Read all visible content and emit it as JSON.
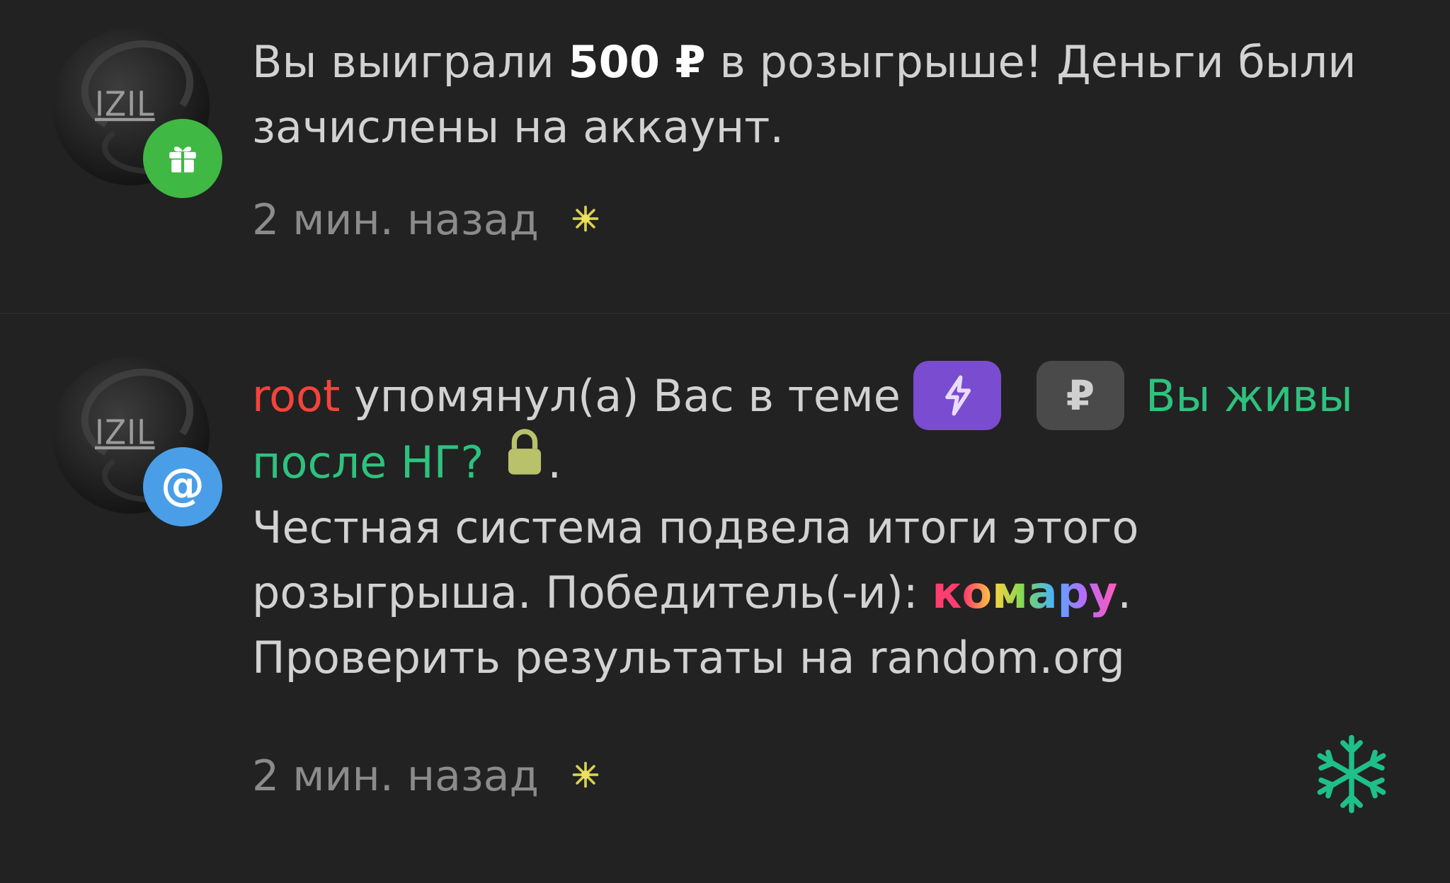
{
  "colors": {
    "background": "#222222",
    "text": "#d2d2d2",
    "muted": "#8b8b8b",
    "username": "#f5433b",
    "topic_link": "#2ec27e",
    "gift_badge": "#3fb844",
    "mention_badge": "#4a9ee8",
    "prefix_purple": "#7a4ccf",
    "prefix_gray": "#4a4a4a",
    "lock": "#b9c26a",
    "snowflake": "#1fbf8a",
    "sparkle": "#d8d050"
  },
  "notifications": [
    {
      "type": "gift",
      "badge_icon": "gift-icon",
      "avatar_text": "IZIL",
      "text_before": "Вы выиграли ",
      "amount": "500 ₽",
      "text_after": " в розыгрыше! Деньги были зачислены на аккаунт.",
      "time": "2 мин. назад",
      "time_icon": "sparkle-icon"
    },
    {
      "type": "mention",
      "badge_icon": "at-icon",
      "badge_text": "@",
      "avatar_text": "IZIL",
      "username": "root",
      "action_text": " упомянул(а) Вас в теме",
      "prefix_icons": [
        "lightning-icon",
        "ruble-icon"
      ],
      "prefix_ruble": "₽",
      "topic_title": "Вы живы после НГ?",
      "topic_icon": "lock-icon",
      "after_topic": ".",
      "body_text": "Честная система подвела итоги этого розыгрыша. Победитель(-и): ",
      "winner": "комару",
      "after_winner": ".",
      "verify_text": "Проверить результаты на random.org",
      "time": "2 мин. назад",
      "time_icon": "sparkle-icon"
    }
  ],
  "decorations": {
    "corner_icon": "snowflake-icon"
  }
}
